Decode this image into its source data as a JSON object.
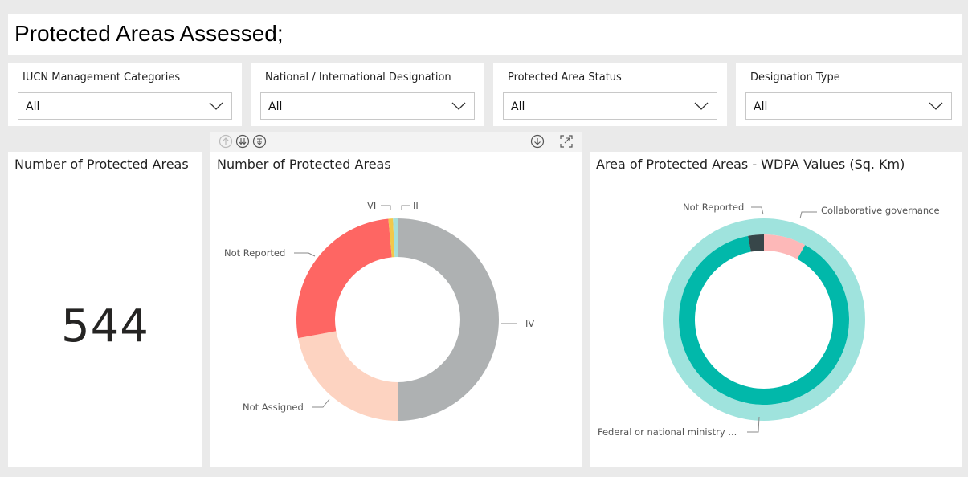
{
  "page": {
    "title": "Protected Areas Assessed;"
  },
  "slicers": [
    {
      "label": "IUCN Management Categories",
      "value": "All"
    },
    {
      "label": "National / International Designation",
      "value": "All"
    },
    {
      "label": "Protected Area Status",
      "value": "All"
    },
    {
      "label": "Designation Type",
      "value": "All"
    }
  ],
  "kpi": {
    "title": "Number of Protected Areas",
    "value": "544"
  },
  "toolbar": {
    "icons": [
      "drill-up-icon",
      "expand-all-down-icon",
      "drill-through-icon",
      "download-icon",
      "focus-mode-icon"
    ]
  },
  "donut1": {
    "title": "Number of Protected Areas",
    "labels": {
      "vi": "VI",
      "ii": "II",
      "not_reported": "Not Reported",
      "iv": "IV",
      "not_assigned": "Not Assigned"
    }
  },
  "donut2": {
    "title": "Area of Protected Areas - WDPA Values (Sq. Km)",
    "labels": {
      "not_reported": "Not Reported",
      "collab": "Collaborative governance",
      "federal": "Federal or national ministry ..."
    }
  },
  "chart_data": [
    {
      "type": "pie",
      "title": "Number of Protected Areas",
      "series": [
        {
          "name": "IV",
          "value": 272,
          "color": "#aeb1b2"
        },
        {
          "name": "Not Assigned",
          "value": 120,
          "color": "#fdd3c1"
        },
        {
          "name": "Not Reported",
          "value": 144,
          "color": "#fe6663"
        },
        {
          "name": "VI",
          "value": 4,
          "color": "#f2c84b"
        },
        {
          "name": "II",
          "value": 4,
          "color": "#a6dfd9"
        }
      ]
    },
    {
      "type": "pie",
      "title": "Area of Protected Areas - WDPA Values (Sq. Km)",
      "series": [
        {
          "name": "Collaborative governance",
          "value": 8,
          "color": "#fdb8b8"
        },
        {
          "name": "Federal or national ministry ...",
          "value": 89,
          "color": "#01b8aa"
        },
        {
          "name": "Not Reported",
          "value": 3,
          "color": "#374649"
        }
      ]
    }
  ]
}
